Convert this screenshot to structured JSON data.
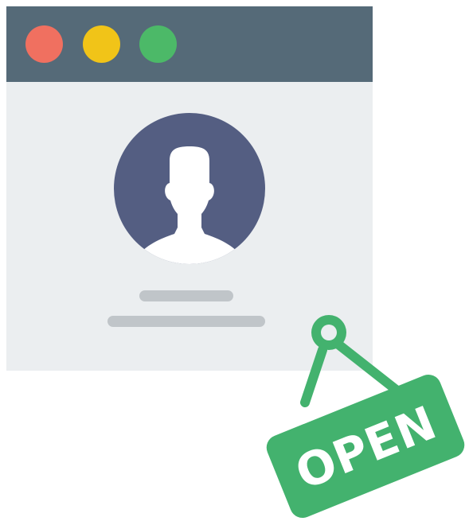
{
  "sign": {
    "label": "OPEN"
  },
  "window": {
    "title_bar_buttons": [
      "close",
      "minimize",
      "maximize"
    ],
    "profile_icon": "user-silhouette-icon"
  },
  "colors": {
    "title_bar": "#556a78",
    "window_body": "#ebeef0",
    "close_dot": "#f07060",
    "minimize_dot": "#f1c418",
    "maximize_dot": "#4cb968",
    "avatar_bg": "#545e82",
    "placeholder_line": "#c0c5c9",
    "sign_green": "#43b26e"
  }
}
